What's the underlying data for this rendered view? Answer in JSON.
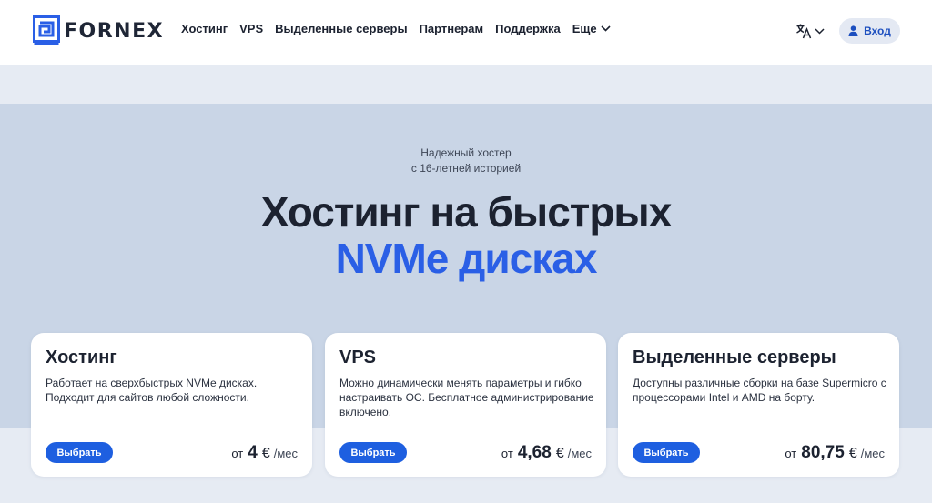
{
  "brand": {
    "name": "FORNEX"
  },
  "nav": {
    "items": [
      {
        "label": "Хостинг"
      },
      {
        "label": "VPS"
      },
      {
        "label": "Выделенные серверы"
      },
      {
        "label": "Партнерам"
      },
      {
        "label": "Поддержка"
      },
      {
        "label": "Еще",
        "icon": "chevron-down-icon"
      }
    ],
    "language_icon": "translate-icon",
    "login_label": "Вход",
    "login_icon": "user-icon"
  },
  "hero": {
    "tagline_line1": "Надежный хостер",
    "tagline_line2": "с 16-летней историей",
    "title_line1": "Хостинг на быстрых",
    "title_line2": "NVMe дисках"
  },
  "cards": [
    {
      "title": "Хостинг",
      "description": "Работает на сверхбыстрых NVMe дисках. Подходит для сайтов любой сложности.",
      "button_label": "Выбрать",
      "price_prefix": "от",
      "price_value": "4",
      "currency": "€",
      "period": "/мес"
    },
    {
      "title": "VPS",
      "description": "Можно динамически менять параметры и гибко настраивать ОС. Бесплатное администрирование включено.",
      "button_label": "Выбрать",
      "price_prefix": "от",
      "price_value": "4,68",
      "currency": "€",
      "period": "/мес"
    },
    {
      "title": "Выделенные серверы",
      "description": "Доступны различные сборки на базе Supermicro с процессорами Intel и AMD на борту.",
      "button_label": "Выбрать",
      "price_prefix": "от",
      "price_value": "80,75",
      "currency": "€",
      "period": "/мес"
    }
  ],
  "colors": {
    "accent": "#1e5fe0",
    "hero_title_highlight": "#2a5fe6",
    "hero_bg": "#c9d5e6",
    "page_bg": "#e6ebf3"
  }
}
